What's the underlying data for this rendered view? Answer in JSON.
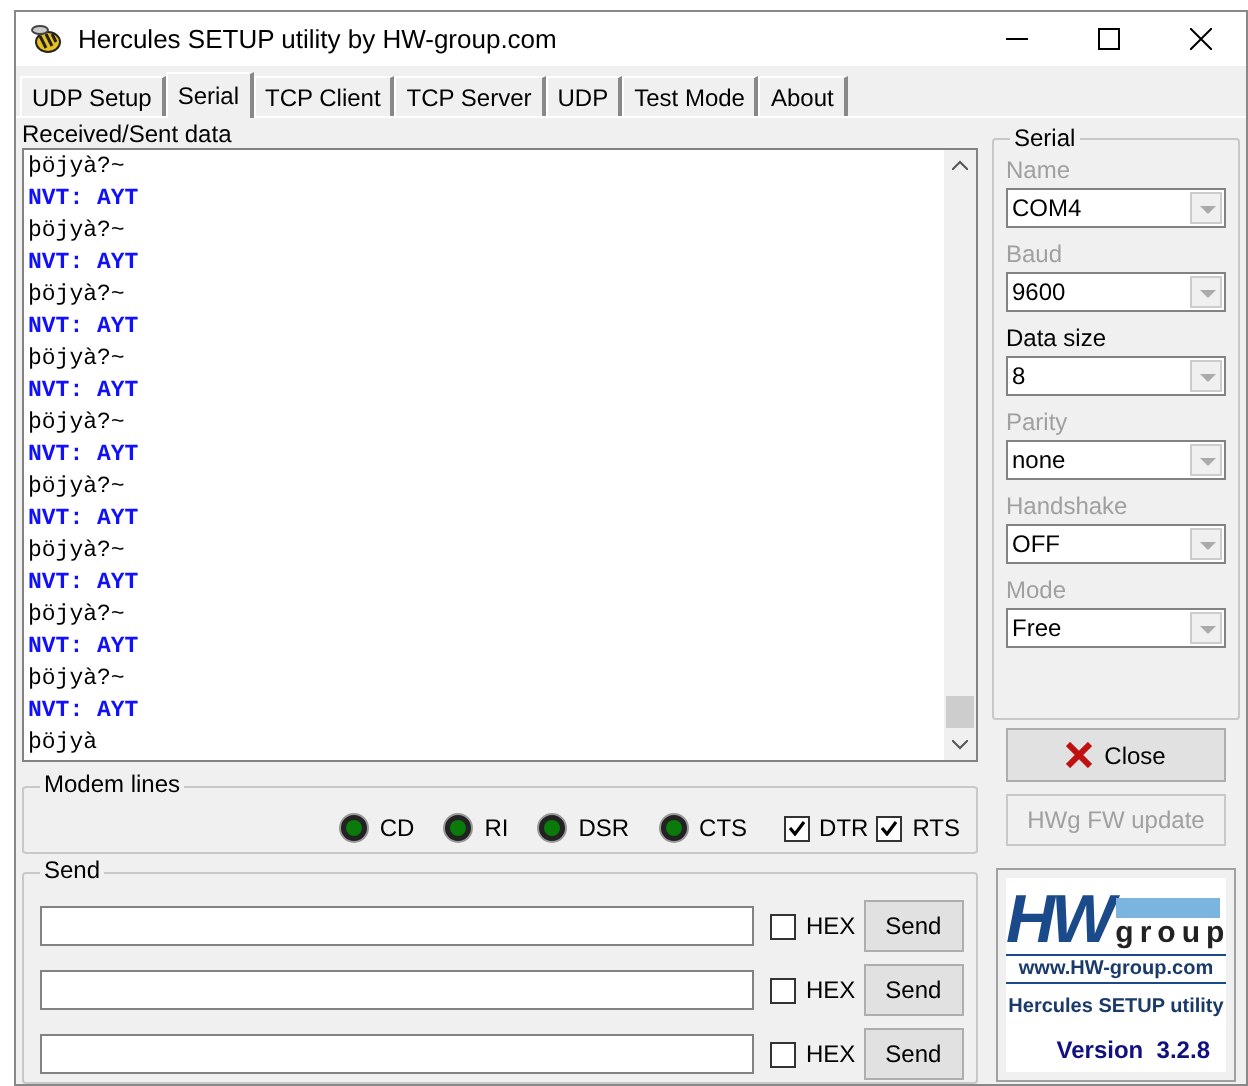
{
  "window": {
    "title": "Hercules SETUP utility by HW-group.com"
  },
  "tabs": [
    {
      "label": "UDP Setup",
      "selected": false
    },
    {
      "label": "Serial",
      "selected": true
    },
    {
      "label": "TCP Client",
      "selected": false
    },
    {
      "label": "TCP Server",
      "selected": false
    },
    {
      "label": "UDP",
      "selected": false
    },
    {
      "label": "Test Mode",
      "selected": false
    },
    {
      "label": "About",
      "selected": false
    }
  ],
  "received": {
    "label": "Received/Sent data",
    "lines": [
      {
        "text": "þöjyà?~",
        "kind": "received"
      },
      {
        "text": "NVT: AYT",
        "kind": "sent"
      },
      {
        "text": "þöjyà?~",
        "kind": "received"
      },
      {
        "text": "NVT: AYT",
        "kind": "sent"
      },
      {
        "text": "þöjyà?~",
        "kind": "received"
      },
      {
        "text": "NVT: AYT",
        "kind": "sent"
      },
      {
        "text": "þöjyà?~",
        "kind": "received"
      },
      {
        "text": "NVT: AYT",
        "kind": "sent"
      },
      {
        "text": "þöjyà?~",
        "kind": "received"
      },
      {
        "text": "NVT: AYT",
        "kind": "sent"
      },
      {
        "text": "þöjyà?~",
        "kind": "received"
      },
      {
        "text": "NVT: AYT",
        "kind": "sent"
      },
      {
        "text": "þöjyà?~",
        "kind": "received"
      },
      {
        "text": "NVT: AYT",
        "kind": "sent"
      },
      {
        "text": "þöjyà?~",
        "kind": "received"
      },
      {
        "text": "NVT: AYT",
        "kind": "sent"
      },
      {
        "text": "þöjyà?~",
        "kind": "received"
      },
      {
        "text": "NVT: AYT",
        "kind": "sent"
      },
      {
        "text": "þöjyà",
        "kind": "received"
      }
    ]
  },
  "modem_lines": {
    "title": "Modem lines",
    "items": [
      {
        "label": "CD",
        "kind": "led"
      },
      {
        "label": "RI",
        "kind": "led"
      },
      {
        "label": "DSR",
        "kind": "led"
      },
      {
        "label": "CTS",
        "kind": "led"
      },
      {
        "label": "DTR",
        "kind": "checkbox",
        "checked": true
      },
      {
        "label": "RTS",
        "kind": "checkbox",
        "checked": true
      }
    ]
  },
  "send": {
    "title": "Send",
    "rows": [
      {
        "hex_label": "HEX",
        "hex_checked": false,
        "button": "Send"
      },
      {
        "hex_label": "HEX",
        "hex_checked": false,
        "button": "Send"
      },
      {
        "hex_label": "HEX",
        "hex_checked": false,
        "button": "Send"
      }
    ]
  },
  "serial": {
    "title": "Serial",
    "fields": [
      {
        "label": "Name",
        "value": "COM4",
        "disabled": true
      },
      {
        "label": "Baud",
        "value": "9600",
        "disabled": true
      },
      {
        "label": "Data size",
        "value": "8",
        "disabled": false
      },
      {
        "label": "Parity",
        "value": "none",
        "disabled": true
      },
      {
        "label": "Handshake",
        "value": "OFF",
        "disabled": true
      },
      {
        "label": "Mode",
        "value": "Free",
        "disabled": true
      }
    ]
  },
  "close_button": "Close",
  "fw_update_button": {
    "label": "HWg FW update",
    "disabled": true
  },
  "logo": {
    "brand_hw": "HW",
    "brand_group": "group",
    "url": "www.HW-group.com",
    "product": "Hercules SETUP utility",
    "version": "Version  3.2.8"
  }
}
